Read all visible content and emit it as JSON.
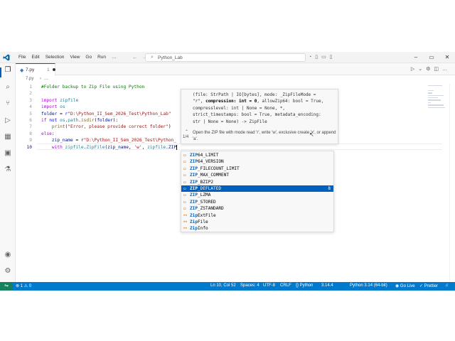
{
  "titlebar": {
    "menu": [
      "File",
      "Edit",
      "Selection",
      "View",
      "Go",
      "Run",
      "…"
    ],
    "search_text": "Python_Lab",
    "window_controls": [
      "–",
      "▭",
      "✕"
    ]
  },
  "tab": {
    "name": "7.py",
    "problems": "1"
  },
  "breadcrumb": {
    "file": "7.py",
    "more": "…"
  },
  "editor": {
    "line_numbers": [
      "1",
      "2",
      "3",
      "4",
      "5",
      "6",
      "7",
      "8",
      "9",
      "10"
    ],
    "current_line": 10
  },
  "signature_help": {
    "line1": "(file: StrPath | IO[bytes], mode: _ZipFileMode =",
    "line2_a": "\"r\", ",
    "line2_b": "compression: int = 0",
    "line2_c": ", allowZip64: bool = True,",
    "line3": "compresslevel: int | None = None, *,",
    "line4": "strict_timestamps: bool = True, metadata_encoding:",
    "line5": "str | None = None) -> ZipFile",
    "counter": "1/4",
    "doc": "Open the ZIP file with mode read 'r', write 'w', exclusive create 'x', or append 'a'."
  },
  "suggestions": [
    {
      "prefix": "ZIP",
      "rest": "64_LIMIT",
      "kind": "constant"
    },
    {
      "prefix": "ZIP",
      "rest": "64_VERSION",
      "kind": "constant"
    },
    {
      "prefix": "ZIP",
      "rest": "_FILECOUNT_LIMIT",
      "kind": "constant"
    },
    {
      "prefix": "ZIP",
      "rest": "_MAX_COMMENT",
      "kind": "constant"
    },
    {
      "prefix": "ZIP",
      "rest": "_BZIP2",
      "kind": "constant"
    },
    {
      "prefix": "ZIP",
      "rest": "_DEFLATED",
      "kind": "constant",
      "selected": true,
      "more": "8"
    },
    {
      "prefix": "ZIP",
      "rest": "_LZMA",
      "kind": "constant"
    },
    {
      "prefix": "ZIP",
      "rest": "_STORED",
      "kind": "constant"
    },
    {
      "prefix": "ZIP",
      "rest": "_ZSTANDARD",
      "kind": "constant"
    },
    {
      "prefix": "Zip",
      "rest": "ExtFile",
      "kind": "class"
    },
    {
      "prefix": "Zip",
      "rest": "File",
      "kind": "class"
    },
    {
      "prefix": "Zip",
      "rest": "Info",
      "kind": "class"
    }
  ],
  "statusbar": {
    "problems": "⊗ 1 ⚠ 0",
    "position": "Ln 10, Col 52",
    "spaces": "Spaces: 4",
    "encoding": "UTF-8",
    "eol": "CRLF",
    "language": "{} Python",
    "version": "3.14.4",
    "interpreter": "Python 3.14 (64-bit)",
    "golive": "◉ Go Live",
    "prettier": "✓ Prettier"
  },
  "colors": {
    "accent": "#007acc",
    "selection": "#0060c0",
    "remote": "#16825d"
  }
}
